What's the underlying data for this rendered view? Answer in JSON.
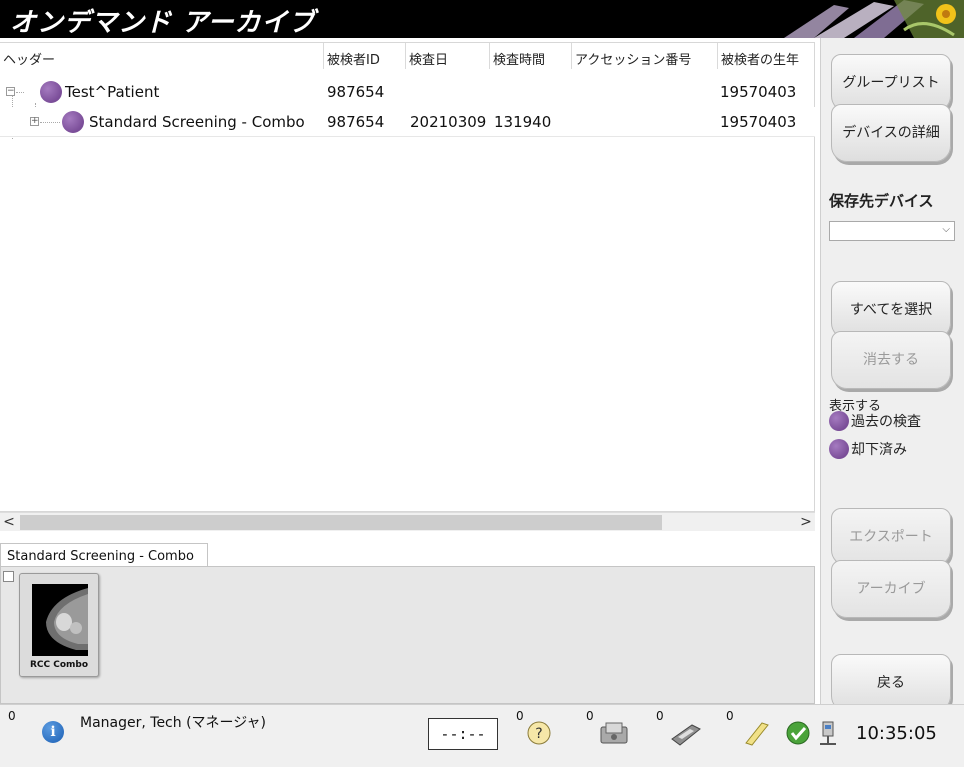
{
  "window": {
    "title": "オンデマンド アーカイブ"
  },
  "grid": {
    "headers": [
      "ヘッダー",
      "被検者ID",
      "検査日",
      "検査時間",
      "アクセッション番号",
      "被検者の生年"
    ],
    "rows": [
      {
        "name": "Test^Patient",
        "patient_id": "987654",
        "date": "",
        "time": "",
        "accession": "",
        "birth": "19570403"
      },
      {
        "name": "Standard Screening - Combo",
        "patient_id": "987654",
        "date": "20210309",
        "time": "131940",
        "accession": "",
        "birth": "19570403"
      }
    ]
  },
  "scroll": {
    "left_arrow": "<",
    "right_arrow": ">"
  },
  "bottom_tab": {
    "label": "Standard Screening - Combo"
  },
  "thumbnail": {
    "caption": "RCC Combo"
  },
  "right_panel": {
    "group_list": "グループリスト",
    "device_details": "デバイスの詳細",
    "destination_label": "保存先デバイス",
    "destination_value": "",
    "select_all": "すべてを選択",
    "clear": "消去する",
    "show_label": "表示する",
    "legend_prior": "過去の検査",
    "legend_rejected": "却下済み",
    "export": "エクスポート",
    "archive": "アーカイブ",
    "back": "戻る"
  },
  "status": {
    "info_count": "0",
    "user": "Manager, Tech (マネージャ)",
    "timer": "--:--",
    "help_count": "0",
    "media_count": "0",
    "print_count": "0",
    "notes_count": "0",
    "time": "10:35:05"
  },
  "colors": {
    "accent_dot": "#7a4d98",
    "titlebar": "#000000"
  }
}
